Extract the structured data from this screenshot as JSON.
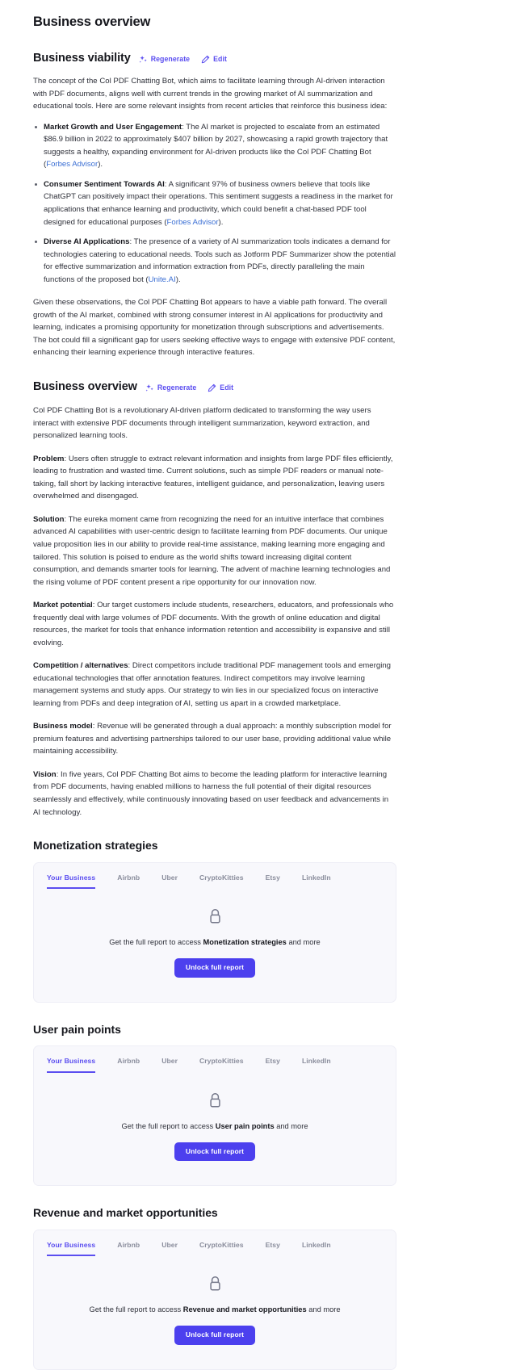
{
  "page": {
    "title": "Business overview"
  },
  "actions": {
    "regenerate_label": "Regenerate",
    "edit_label": "Edit"
  },
  "colors": {
    "accent": "#5b4ef0",
    "button": "#4c40ee",
    "link": "#3b6fd4",
    "card_bg": "#f8f8fc",
    "text": "#2e3039",
    "muted": "#8a8d9c"
  },
  "viability": {
    "heading": "Business viability",
    "intro": "The concept of the Col PDF Chatting Bot, which aims to facilitate learning through AI-driven interaction with PDF documents, aligns well with current trends in the growing market of AI summarization and educational tools. Here are some relevant insights from recent articles that reinforce this business idea:",
    "bullets": [
      {
        "title": "Market Growth and User Engagement",
        "text_before": ": The AI market is projected to escalate from an estimated $86.9 billion in 2022 to approximately $407 billion by 2027, showcasing a rapid growth trajectory that suggests a healthy, expanding environment for AI-driven products like the Col PDF Chatting Bot (",
        "link": "Forbes Advisor",
        "text_after": ")."
      },
      {
        "title": "Consumer Sentiment Towards AI",
        "text_before": ": A significant 97% of business owners believe that tools like ChatGPT can positively impact their operations. This sentiment suggests a readiness in the market for applications that enhance learning and productivity, which could benefit a chat-based PDF tool designed for educational purposes (",
        "link": "Forbes Advisor",
        "text_after": ")."
      },
      {
        "title": "Diverse AI Applications",
        "text_before": ": The presence of a variety of AI summarization tools indicates a demand for technologies catering to educational needs. Tools such as Jotform PDF Summarizer show the potential for effective summarization and information extraction from PDFs, directly paralleling the main functions of the proposed bot (",
        "link": "Unite.AI",
        "text_after": ")."
      }
    ],
    "conclusion": "Given these observations, the Col PDF Chatting Bot appears to have a viable path forward. The overall growth of the AI market, combined with strong consumer interest in AI applications for productivity and learning, indicates a promising opportunity for monetization through subscriptions and advertisements. The bot could fill a significant gap for users seeking effective ways to engage with extensive PDF content, enhancing their learning experience through interactive features."
  },
  "overview": {
    "heading": "Business overview",
    "intro": "Col PDF Chatting Bot is a revolutionary AI-driven platform dedicated to transforming the way users interact with extensive PDF documents through intelligent summarization, keyword extraction, and personalized learning tools.",
    "paragraphs": [
      {
        "label": "Problem",
        "text": ": Users often struggle to extract relevant information and insights from large PDF files efficiently, leading to frustration and wasted time. Current solutions, such as simple PDF readers or manual note-taking, fall short by lacking interactive features, intelligent guidance, and personalization, leaving users overwhelmed and disengaged."
      },
      {
        "label": "Solution",
        "text": ": The eureka moment came from recognizing the need for an intuitive interface that combines advanced AI capabilities with user-centric design to facilitate learning from PDF documents. Our unique value proposition lies in our ability to provide real-time assistance, making learning more engaging and tailored. This solution is poised to endure as the world shifts toward increasing digital content consumption, and demands smarter tools for learning. The advent of machine learning technologies and the rising volume of PDF content present a ripe opportunity for our innovation now."
      },
      {
        "label": "Market potential",
        "text": ": Our target customers include students, researchers, educators, and professionals who frequently deal with large volumes of PDF documents. With the growth of online education and digital resources, the market for tools that enhance information retention and accessibility is expansive and still evolving."
      },
      {
        "label": "Competition / alternatives",
        "text": ": Direct competitors include traditional PDF management tools and emerging educational technologies that offer annotation features. Indirect competitors may involve learning management systems and study apps. Our strategy to win lies in our specialized focus on interactive learning from PDFs and deep integration of AI, setting us apart in a crowded marketplace."
      },
      {
        "label": "Business model",
        "text": ": Revenue will be generated through a dual approach: a monthly subscription model for premium features and advertising partnerships tailored to our user base, providing additional value while maintaining accessibility."
      },
      {
        "label": "Vision",
        "text": ": In five years, Col PDF Chatting Bot aims to become the leading platform for interactive learning from PDF documents, having enabled millions to harness the full potential of their digital resources seamlessly and effectively, while continuously innovating based on user feedback and advancements in AI technology."
      }
    ]
  },
  "locked_sections": [
    {
      "heading": "Monetization strategies",
      "tabs": [
        {
          "label": "Your Business",
          "active": true
        },
        {
          "label": "Airbnb",
          "active": false
        },
        {
          "label": "Uber",
          "active": false
        },
        {
          "label": "CryptoKitties",
          "active": false
        },
        {
          "label": "Etsy",
          "active": false
        },
        {
          "label": "LinkedIn",
          "active": false
        }
      ],
      "prompt_prefix": "Get the full report to access ",
      "prompt_bold": "Monetization strategies",
      "prompt_suffix": " and more",
      "button_label": "Unlock full report"
    },
    {
      "heading": "User pain points",
      "tabs": [
        {
          "label": "Your Business",
          "active": true
        },
        {
          "label": "Airbnb",
          "active": false
        },
        {
          "label": "Uber",
          "active": false
        },
        {
          "label": "CryptoKitties",
          "active": false
        },
        {
          "label": "Etsy",
          "active": false
        },
        {
          "label": "LinkedIn",
          "active": false
        }
      ],
      "prompt_prefix": "Get the full report to access ",
      "prompt_bold": "User pain points",
      "prompt_suffix": " and more",
      "button_label": "Unlock full report"
    },
    {
      "heading": "Revenue and market opportunities",
      "tabs": [
        {
          "label": "Your Business",
          "active": true
        },
        {
          "label": "Airbnb",
          "active": false
        },
        {
          "label": "Uber",
          "active": false
        },
        {
          "label": "CryptoKitties",
          "active": false
        },
        {
          "label": "Etsy",
          "active": false
        },
        {
          "label": "LinkedIn",
          "active": false
        }
      ],
      "prompt_prefix": "Get the full report to access ",
      "prompt_bold": "Revenue and market opportunities",
      "prompt_suffix": " and more",
      "button_label": "Unlock full report"
    }
  ]
}
